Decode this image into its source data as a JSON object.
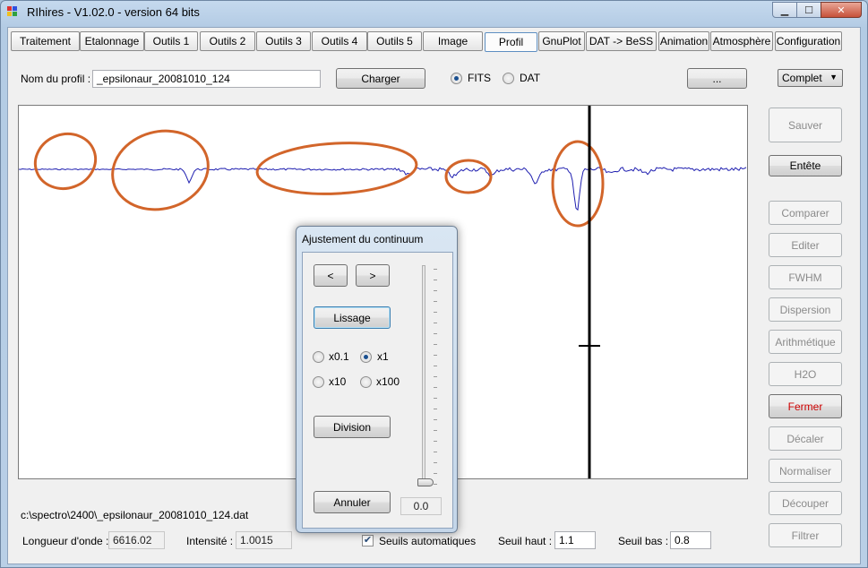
{
  "window": {
    "title": "RIhires - V1.02.0 - version 64 bits",
    "controls": {
      "minimize": "▁",
      "maximize": "☐",
      "close": "✕"
    }
  },
  "tabs": [
    {
      "label": "Traitement"
    },
    {
      "label": "Etalonnage"
    },
    {
      "label": "Outils 1"
    },
    {
      "label": "Outils 2"
    },
    {
      "label": "Outils 3"
    },
    {
      "label": "Outils 4"
    },
    {
      "label": "Outils 5"
    },
    {
      "label": "Image"
    },
    {
      "label": "Profil"
    },
    {
      "label": "GnuPlot"
    },
    {
      "label": "DAT -> BeSS"
    },
    {
      "label": "Animation"
    },
    {
      "label": "Atmosphère"
    },
    {
      "label": "Configuration"
    }
  ],
  "profile": {
    "name_label": "Nom du profil :",
    "name_value": "_epsilonaur_20081010_124",
    "load_button": "Charger",
    "fits_label": "FITS",
    "dat_label": "DAT",
    "format_selected": "FITS",
    "browse_button": "...",
    "mode_selected": "Complet"
  },
  "side_buttons": [
    {
      "label": "Sauver",
      "enabled": false
    },
    {
      "label": "Entête",
      "enabled": true
    },
    {
      "label": "Comparer",
      "enabled": false
    },
    {
      "label": "Editer",
      "enabled": false
    },
    {
      "label": "FWHM",
      "enabled": false
    },
    {
      "label": "Dispersion",
      "enabled": false
    },
    {
      "label": "Arithmétique",
      "enabled": false
    },
    {
      "label": "H2O",
      "enabled": false
    },
    {
      "label": "Fermer",
      "enabled": true
    },
    {
      "label": "Décaler",
      "enabled": false
    },
    {
      "label": "Normaliser",
      "enabled": false
    },
    {
      "label": "Découper",
      "enabled": false
    },
    {
      "label": "Filtrer",
      "enabled": false
    }
  ],
  "status": {
    "file_path": "c:\\spectro\\2400\\_epsilonaur_20081010_124.dat",
    "wavelength_label": "Longueur d'onde :",
    "wavelength_value": "6616.02",
    "intensity_label": "Intensité :",
    "intensity_value": "1.0015",
    "auto_threshold_label": "Seuils automatiques",
    "auto_threshold_checked": true,
    "high_threshold_label": "Seuil haut :",
    "high_threshold_value": "1.1",
    "low_threshold_label": "Seuil bas :",
    "low_threshold_value": "0.8"
  },
  "dialog": {
    "title": "Ajustement du continuum",
    "prev_button": "<",
    "next_button": ">",
    "smooth_button": "Lissage",
    "factor_x01": "x0.1",
    "factor_x1": "x1",
    "factor_x10": "x10",
    "factor_x100": "x100",
    "factor_selected": "x1",
    "division_button": "Division",
    "cancel_button": "Annuler",
    "slider_value": "0.0",
    "slider_position": 0.0
  },
  "colors": {
    "spectrum": "#1f1fb0",
    "annotation": "#d2652a",
    "cursor": "#000000",
    "close_text": "#cc0000"
  }
}
